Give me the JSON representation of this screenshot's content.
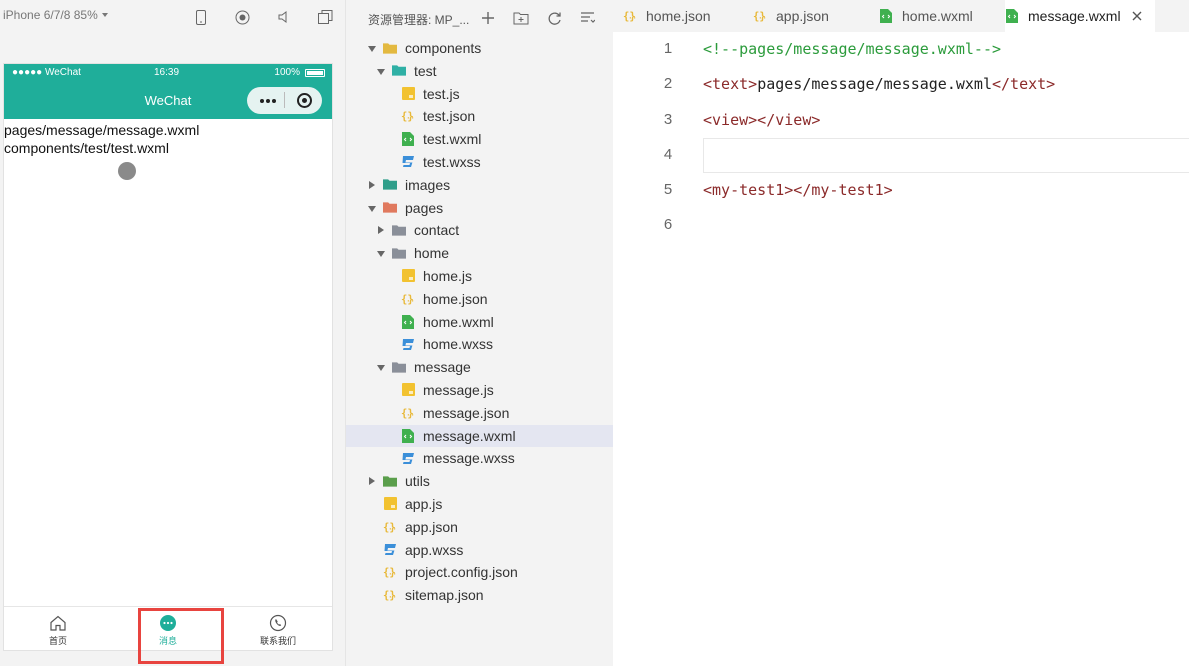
{
  "simulator": {
    "device_label": "iPhone 6/7/8 85%",
    "status_bar": {
      "carrier": "●●●●● WeChat",
      "time": "16:39",
      "battery": "100%"
    },
    "nav_title": "WeChat",
    "page_lines": [
      "pages/message/message.wxml",
      "components/test/test.wxml"
    ],
    "tabs": [
      {
        "label": "首页",
        "icon": "home-icon"
      },
      {
        "label": "消息",
        "icon": "message-icon"
      },
      {
        "label": "联系我们",
        "icon": "phone-icon"
      }
    ],
    "active_tab": "消息",
    "accent_color": "#1fae9a",
    "highlight_color": "#e8443f"
  },
  "explorer": {
    "title": "资源管理器: MP_...",
    "tree": [
      {
        "label": "components",
        "type": "folder",
        "open": true,
        "depth": 0,
        "color": "#e3b940"
      },
      {
        "label": "test",
        "type": "folder",
        "open": true,
        "depth": 1,
        "color": "#2fb0a5"
      },
      {
        "label": "test.js",
        "type": "js",
        "depth": 2
      },
      {
        "label": "test.json",
        "type": "json",
        "depth": 2
      },
      {
        "label": "test.wxml",
        "type": "wxml",
        "depth": 2
      },
      {
        "label": "test.wxss",
        "type": "wxss",
        "depth": 2
      },
      {
        "label": "images",
        "type": "folder",
        "open": false,
        "depth": 0,
        "color": "#2f9e8a"
      },
      {
        "label": "pages",
        "type": "folder",
        "open": true,
        "depth": 0,
        "color": "#e0795e"
      },
      {
        "label": "contact",
        "type": "folder",
        "open": false,
        "depth": 1,
        "color": "#8a8f99"
      },
      {
        "label": "home",
        "type": "folder",
        "open": true,
        "depth": 1,
        "color": "#8a8f99"
      },
      {
        "label": "home.js",
        "type": "js",
        "depth": 2
      },
      {
        "label": "home.json",
        "type": "json",
        "depth": 2
      },
      {
        "label": "home.wxml",
        "type": "wxml",
        "depth": 2
      },
      {
        "label": "home.wxss",
        "type": "wxss",
        "depth": 2
      },
      {
        "label": "message",
        "type": "folder",
        "open": true,
        "depth": 1,
        "color": "#8a8f99"
      },
      {
        "label": "message.js",
        "type": "js",
        "depth": 2
      },
      {
        "label": "message.json",
        "type": "json",
        "depth": 2
      },
      {
        "label": "message.wxml",
        "type": "wxml",
        "depth": 2,
        "selected": true
      },
      {
        "label": "message.wxss",
        "type": "wxss",
        "depth": 2
      },
      {
        "label": "utils",
        "type": "folder",
        "open": false,
        "depth": 0,
        "color": "#5a9e4b"
      },
      {
        "label": "app.js",
        "type": "js",
        "depth": 0
      },
      {
        "label": "app.json",
        "type": "json",
        "depth": 0
      },
      {
        "label": "app.wxss",
        "type": "wxss",
        "depth": 0
      },
      {
        "label": "project.config.json",
        "type": "json",
        "depth": 0
      },
      {
        "label": "sitemap.json",
        "type": "json",
        "depth": 0
      }
    ]
  },
  "editor": {
    "tabs": [
      {
        "label": "home.json",
        "type": "json"
      },
      {
        "label": "app.json",
        "type": "json"
      },
      {
        "label": "home.wxml",
        "type": "wxml"
      },
      {
        "label": "message.wxml",
        "type": "wxml",
        "active": true
      }
    ],
    "lines": [
      {
        "num": "1",
        "tokens": [
          {
            "t": "<!--pages/message/message.wxml-->",
            "c": "comment"
          }
        ]
      },
      {
        "num": "2",
        "tokens": [
          {
            "t": "<text>",
            "c": "tag"
          },
          {
            "t": "pages/message/message.wxml",
            "c": "text"
          },
          {
            "t": "</text>",
            "c": "tag"
          }
        ]
      },
      {
        "num": "3",
        "tokens": [
          {
            "t": "<view></view>",
            "c": "tag"
          }
        ]
      },
      {
        "num": "4",
        "tokens": [],
        "active": true
      },
      {
        "num": "5",
        "tokens": [
          {
            "t": "<my-test1></my-test1>",
            "c": "tag"
          }
        ]
      },
      {
        "num": "6",
        "tokens": []
      }
    ]
  },
  "file_colors": {
    "js": "#f2c230",
    "json": "#e8b93a",
    "wxml": "#3fb04f",
    "wxss": "#3b8fd9"
  }
}
